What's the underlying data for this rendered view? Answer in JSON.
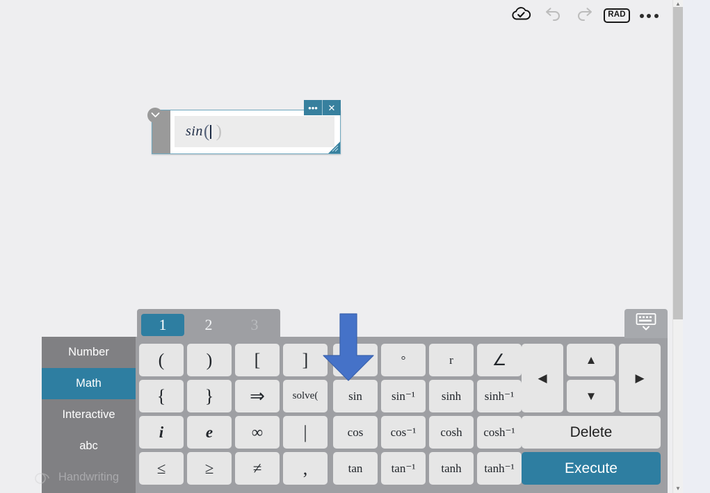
{
  "toolbar": {
    "cloud_icon": "cloud-check-icon",
    "undo_icon": "undo-icon",
    "redo_icon": "redo-icon",
    "angle_mode": "RAD",
    "more_icon": "more-options-icon"
  },
  "mathbox": {
    "expression": "sin",
    "paren_open": "(",
    "paren_close": ")",
    "caret": "",
    "menu_label": "•••",
    "close_label": "✕",
    "collapse_icon": "chevron-down-icon",
    "resize_icon": "resize-grip-icon"
  },
  "keyboard": {
    "tabs": [
      {
        "label": "1",
        "state": "active"
      },
      {
        "label": "2",
        "state": "enabled"
      },
      {
        "label": "3",
        "state": "disabled"
      }
    ],
    "hide_icon": "hide-keyboard-icon",
    "sidebar": [
      {
        "label": "Number",
        "state": "enabled"
      },
      {
        "label": "Math",
        "state": "active"
      },
      {
        "label": "Interactive",
        "state": "enabled"
      },
      {
        "label": "abc",
        "state": "enabled"
      },
      {
        "label": "Handwriting",
        "state": "disabled"
      }
    ],
    "left_keys": [
      {
        "label": "(",
        "style": "sym-big"
      },
      {
        "label": ")",
        "style": "sym-big"
      },
      {
        "label": "[",
        "style": "sym-big"
      },
      {
        "label": "]",
        "style": "sym-big"
      },
      {
        "label": "{",
        "style": "sym-big"
      },
      {
        "label": "}",
        "style": "sym-big"
      },
      {
        "label": "⇒",
        "style": "sym-big"
      },
      {
        "label": "solve(",
        "style": "small"
      },
      {
        "label": "i",
        "style": "italic-bold"
      },
      {
        "label": "e",
        "style": "italic-bold"
      },
      {
        "label": "∞",
        "style": "sym-med"
      },
      {
        "label": "|",
        "style": "sym-big"
      },
      {
        "label": "≤",
        "style": "sym-med"
      },
      {
        "label": "≥",
        "style": "sym-med"
      },
      {
        "label": "≠",
        "style": "sym-med"
      },
      {
        "label": ",",
        "style": "sym-big"
      }
    ],
    "right_keys": [
      {
        "label": "",
        "style": "word",
        "note": "obscured-by-arrow"
      },
      {
        "label": "°",
        "style": "word"
      },
      {
        "label": "r",
        "style": "word"
      },
      {
        "label": "∠",
        "style": "sym-med"
      },
      {
        "label": "sin",
        "style": "word"
      },
      {
        "label": "sin⁻¹",
        "style": "word"
      },
      {
        "label": "sinh",
        "style": "word"
      },
      {
        "label": "sinh⁻¹",
        "style": "word"
      },
      {
        "label": "cos",
        "style": "word"
      },
      {
        "label": "cos⁻¹",
        "style": "word"
      },
      {
        "label": "cosh",
        "style": "word"
      },
      {
        "label": "cosh⁻¹",
        "style": "word"
      },
      {
        "label": "tan",
        "style": "word"
      },
      {
        "label": "tan⁻¹",
        "style": "word"
      },
      {
        "label": "tanh",
        "style": "word"
      },
      {
        "label": "tanh⁻¹",
        "style": "word"
      }
    ],
    "nav": {
      "left_icon": "arrow-left-icon",
      "up_icon": "arrow-up-icon",
      "down_icon": "arrow-down-icon",
      "right_icon": "arrow-right-icon",
      "left_glyph": "◀",
      "up_glyph": "▲",
      "down_glyph": "▼",
      "right_glyph": "▶"
    },
    "delete_label": "Delete",
    "execute_label": "Execute"
  },
  "annotation": {
    "arrow_icon": "down-arrow-annotation",
    "points_at": "sin"
  },
  "scrollbar": {
    "up_glyph": "▲",
    "down_glyph": "▼"
  },
  "colors": {
    "accent_teal": "#2e7ea1",
    "keyboard_gray": "#9e9fa3",
    "sidebar_gray": "#808083",
    "key_gray": "#e6e6e6",
    "annotation_blue": "#4572c8",
    "canvas": "#eeeef0"
  }
}
